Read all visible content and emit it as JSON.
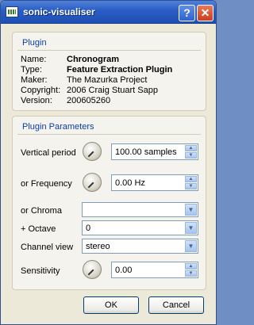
{
  "window": {
    "title": "sonic-visualiser",
    "help_glyph": "?",
    "close_glyph": "✕"
  },
  "plugin": {
    "heading": "Plugin",
    "rows": [
      {
        "key": "Name:",
        "value": "Chronogram"
      },
      {
        "key": "Type:",
        "value": "Feature Extraction Plugin"
      },
      {
        "key": "Maker:",
        "value": "The Mazurka Project"
      },
      {
        "key": "Copyright:",
        "value": "2006 Craig Stuart Sapp"
      },
      {
        "key": "Version:",
        "value": "200605260"
      }
    ]
  },
  "parameters": {
    "heading": "Plugin Parameters",
    "vertical_period": {
      "label": "Vertical period",
      "value": "100.00 samples"
    },
    "frequency": {
      "label": "or Frequency",
      "value": "0.00 Hz"
    },
    "chroma": {
      "label": "or Chroma",
      "value": ""
    },
    "octave": {
      "label": "+ Octave",
      "value": "0"
    },
    "channel_view": {
      "label": "Channel view",
      "value": "stereo"
    },
    "sensitivity": {
      "label": "Sensitivity",
      "value": "0.00"
    },
    "icons": {
      "up": "▲",
      "down": "▼"
    }
  },
  "buttons": {
    "ok": "OK",
    "cancel": "Cancel"
  }
}
